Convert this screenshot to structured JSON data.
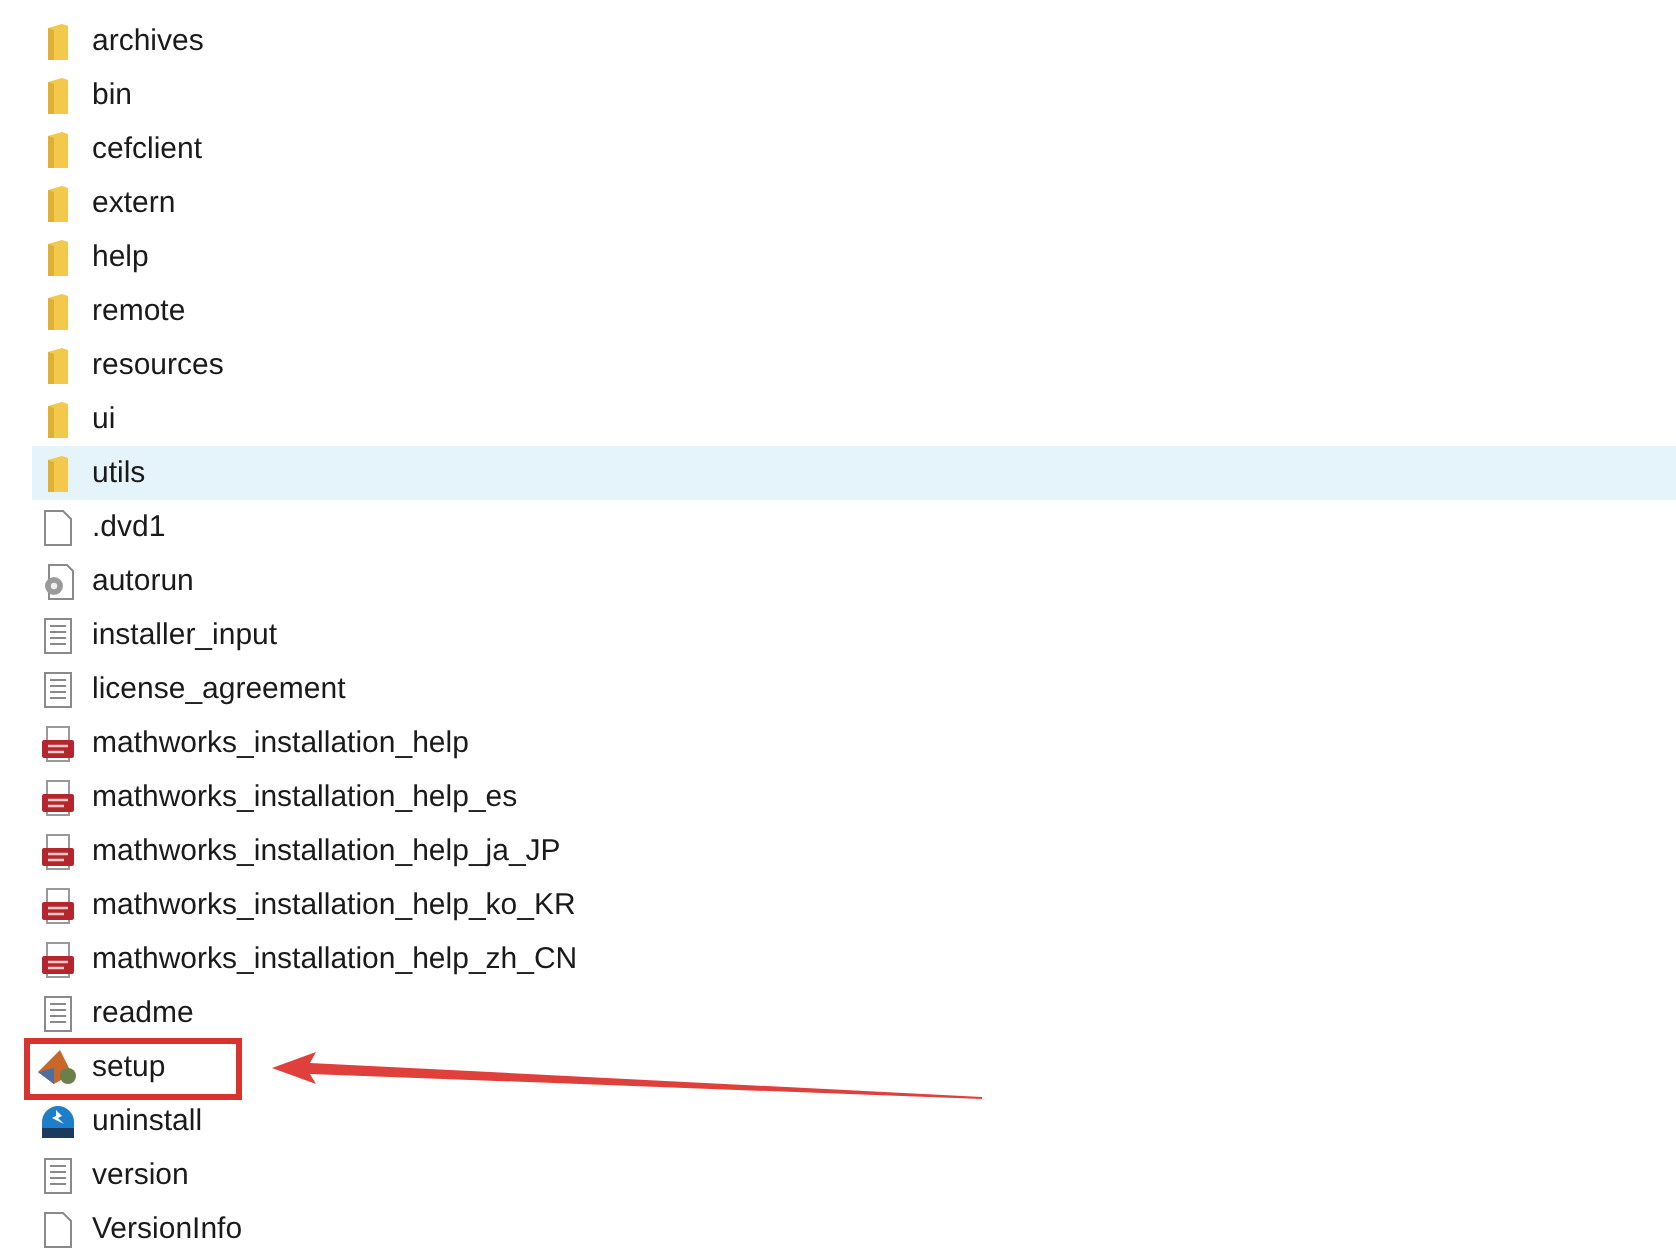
{
  "items": [
    {
      "name": "archives",
      "kind": "folder",
      "selected": false,
      "highlighted": false
    },
    {
      "name": "bin",
      "kind": "folder",
      "selected": false,
      "highlighted": false
    },
    {
      "name": "cefclient",
      "kind": "folder",
      "selected": false,
      "highlighted": false
    },
    {
      "name": "extern",
      "kind": "folder",
      "selected": false,
      "highlighted": false
    },
    {
      "name": "help",
      "kind": "folder",
      "selected": false,
      "highlighted": false
    },
    {
      "name": "remote",
      "kind": "folder",
      "selected": false,
      "highlighted": false
    },
    {
      "name": "resources",
      "kind": "folder",
      "selected": false,
      "highlighted": false
    },
    {
      "name": "ui",
      "kind": "folder",
      "selected": false,
      "highlighted": false
    },
    {
      "name": "utils",
      "kind": "folder",
      "selected": true,
      "highlighted": false
    },
    {
      "name": ".dvd1",
      "kind": "blank",
      "selected": false,
      "highlighted": false
    },
    {
      "name": "autorun",
      "kind": "settings",
      "selected": false,
      "highlighted": false
    },
    {
      "name": "installer_input",
      "kind": "text",
      "selected": false,
      "highlighted": false
    },
    {
      "name": "license_agreement",
      "kind": "text",
      "selected": false,
      "highlighted": false
    },
    {
      "name": "mathworks_installation_help",
      "kind": "pdf",
      "selected": false,
      "highlighted": false
    },
    {
      "name": "mathworks_installation_help_es",
      "kind": "pdf",
      "selected": false,
      "highlighted": false
    },
    {
      "name": "mathworks_installation_help_ja_JP",
      "kind": "pdf",
      "selected": false,
      "highlighted": false
    },
    {
      "name": "mathworks_installation_help_ko_KR",
      "kind": "pdf",
      "selected": false,
      "highlighted": false
    },
    {
      "name": "mathworks_installation_help_zh_CN",
      "kind": "pdf",
      "selected": false,
      "highlighted": false
    },
    {
      "name": "readme",
      "kind": "text",
      "selected": false,
      "highlighted": false
    },
    {
      "name": "setup",
      "kind": "app",
      "selected": false,
      "highlighted": true
    },
    {
      "name": "uninstall",
      "kind": "archive",
      "selected": false,
      "highlighted": false
    },
    {
      "name": "version",
      "kind": "text",
      "selected": false,
      "highlighted": false
    },
    {
      "name": "VersionInfo",
      "kind": "blank",
      "selected": false,
      "highlighted": false
    }
  ]
}
